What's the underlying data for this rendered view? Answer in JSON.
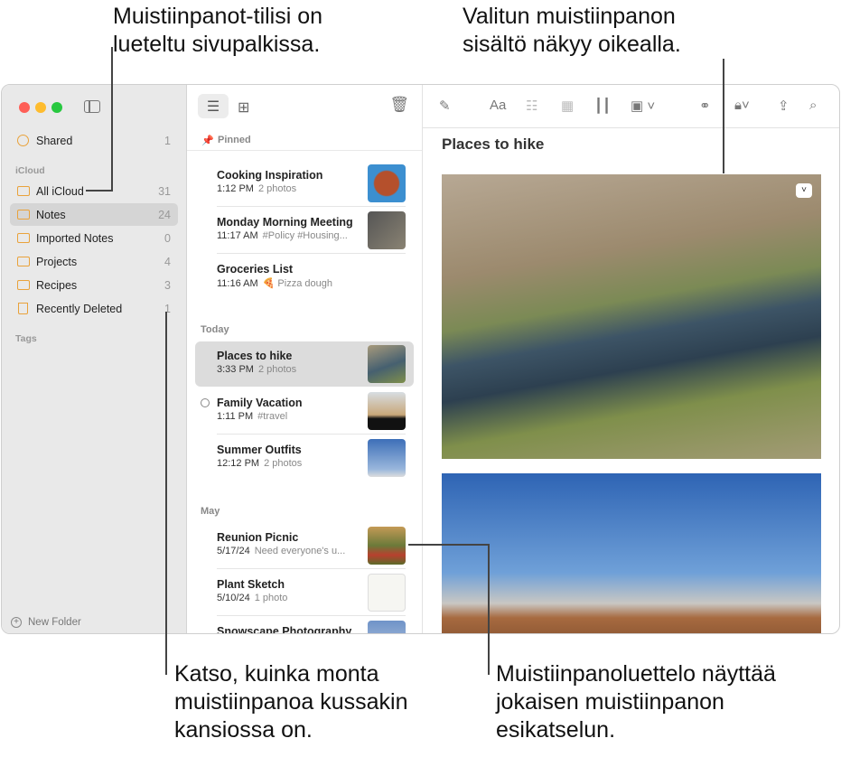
{
  "callouts": {
    "top_left": [
      "Muistiinpanot-tilisi on",
      "lueteltu sivupalkissa."
    ],
    "top_right": [
      "Valitun muistiinpanon",
      "sisältö näkyy oikealla."
    ],
    "bottom_left": [
      "Katso, kuinka monta",
      "muistiinpanoa kussakin",
      "kansiossa on."
    ],
    "bottom_right": [
      "Muistiinpanoluettelo näyttää",
      "jokaisen muistiinpanon",
      "esikatselun."
    ]
  },
  "sidebar": {
    "shared": {
      "label": "Shared",
      "count": "1"
    },
    "icloud_header": "iCloud",
    "folders": [
      {
        "label": "All iCloud",
        "count": "31"
      },
      {
        "label": "Notes",
        "count": "24"
      },
      {
        "label": "Imported Notes",
        "count": "0"
      },
      {
        "label": "Projects",
        "count": "4"
      },
      {
        "label": "Recipes",
        "count": "3"
      },
      {
        "label": "Recently Deleted",
        "count": "1"
      }
    ],
    "tags_header": "Tags",
    "new_folder": "New Folder"
  },
  "list": {
    "sections": {
      "pinned": "Pinned",
      "today": "Today",
      "may": "May"
    },
    "notes": [
      {
        "title": "Cooking Inspiration",
        "time": "1:12 PM",
        "preview": "2 photos"
      },
      {
        "title": "Monday Morning Meeting",
        "time": "11:17 AM",
        "preview": "#Policy #Housing..."
      },
      {
        "title": "Groceries List",
        "time": "11:16 AM",
        "preview": "🍕 Pizza dough"
      },
      {
        "title": "Places to hike",
        "time": "3:33 PM",
        "preview": "2 photos"
      },
      {
        "title": "Family Vacation",
        "time": "1:11 PM",
        "preview": "#travel"
      },
      {
        "title": "Summer Outfits",
        "time": "12:12 PM",
        "preview": "2 photos"
      },
      {
        "title": "Reunion Picnic",
        "time": "5/17/24",
        "preview": "Need everyone's u..."
      },
      {
        "title": "Plant Sketch",
        "time": "5/10/24",
        "preview": "1 photo"
      },
      {
        "title": "Snowscape Photography",
        "time": "",
        "preview": ""
      }
    ]
  },
  "editor": {
    "title": "Places to hike",
    "format_label": "Aa"
  },
  "colors": {
    "close": "#fe5f57",
    "minimize": "#febc2e",
    "zoom": "#28c840",
    "folder": "#e9a23b"
  }
}
